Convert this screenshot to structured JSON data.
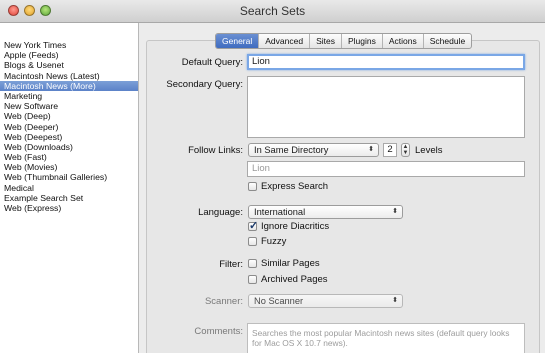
{
  "window": {
    "title": "Search Sets"
  },
  "sidebar": {
    "items": [
      {
        "label": "New York Times",
        "selected": false
      },
      {
        "label": "Apple (Feeds)",
        "selected": false
      },
      {
        "label": "Blogs & Usenet",
        "selected": false
      },
      {
        "label": "Macintosh News (Latest)",
        "selected": false
      },
      {
        "label": "Macintosh News (More)",
        "selected": true
      },
      {
        "label": "Marketing",
        "selected": false
      },
      {
        "label": "New Software",
        "selected": false
      },
      {
        "label": "Web (Deep)",
        "selected": false
      },
      {
        "label": "Web (Deeper)",
        "selected": false
      },
      {
        "label": "Web (Deepest)",
        "selected": false
      },
      {
        "label": "Web (Downloads)",
        "selected": false
      },
      {
        "label": "Web (Fast)",
        "selected": false
      },
      {
        "label": "Web (Movies)",
        "selected": false
      },
      {
        "label": "Web (Thumbnail Galleries)",
        "selected": false
      },
      {
        "label": "Medical",
        "selected": false
      },
      {
        "label": "Example Search Set",
        "selected": false
      },
      {
        "label": "Web (Express)",
        "selected": false
      }
    ]
  },
  "tabs": [
    {
      "label": "General",
      "selected": true
    },
    {
      "label": "Advanced",
      "selected": false
    },
    {
      "label": "Sites",
      "selected": false
    },
    {
      "label": "Plugins",
      "selected": false
    },
    {
      "label": "Actions",
      "selected": false
    },
    {
      "label": "Schedule",
      "selected": false
    }
  ],
  "form": {
    "default_query_label": "Default Query:",
    "default_query_value": "Lion",
    "secondary_query_label": "Secondary Query:",
    "follow_links_label": "Follow Links:",
    "follow_links_value": "In Same Directory",
    "levels_value": "2",
    "levels_label": "Levels",
    "follow_links_placeholder": "Lion",
    "express_search_label": "Express Search",
    "express_search_checked": false,
    "language_label": "Language:",
    "language_value": "International",
    "ignore_diacritics_label": "Ignore Diacritics",
    "ignore_diacritics_checked": true,
    "fuzzy_label": "Fuzzy",
    "fuzzy_checked": false,
    "filter_label": "Filter:",
    "similar_pages_label": "Similar Pages",
    "similar_pages_checked": false,
    "archived_pages_label": "Archived Pages",
    "archived_pages_checked": false,
    "scanner_label": "Scanner:",
    "scanner_value": "No Scanner",
    "comments_label": "Comments:",
    "comments_value": "Searches the most popular Macintosh news sites (default query looks for Mac OS X 10.7 news)."
  },
  "icons": {
    "popup_arrows": "up-down-chevron-icon",
    "checkmark": "checkmark-icon",
    "stepper": "stepper-icon"
  },
  "colors": {
    "selection": "#5b82c8",
    "focus_ring": "#7aa7e6"
  }
}
